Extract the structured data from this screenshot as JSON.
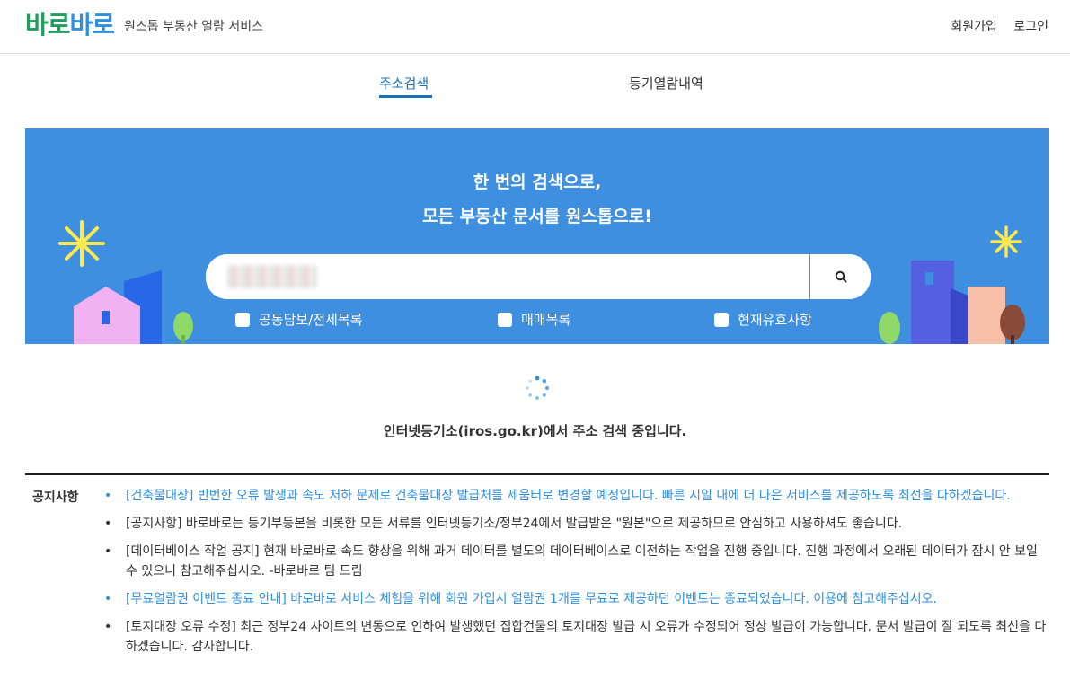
{
  "header": {
    "logo_part1": "바로",
    "logo_part2": "바로",
    "subtitle": "원스톱 부동산 열람 서비스",
    "signup": "회원가입",
    "login": "로그인"
  },
  "tabs": [
    {
      "label": "주소검색",
      "active": true
    },
    {
      "label": "등기열람내역",
      "active": false
    }
  ],
  "hero": {
    "line1": "한 번의 검색으로,",
    "line2": "모든 부동산 문서를 원스톱으로!",
    "search_icon": "search-icon",
    "checkboxes": [
      {
        "label": "공동담보/전세목록",
        "checked": false
      },
      {
        "label": "매매목록",
        "checked": false
      },
      {
        "label": "현재유효사항",
        "checked": false
      }
    ],
    "bg_color": "#3e8fe0"
  },
  "loading": {
    "message": "인터넷등기소(iros.go.kr)에서 주소 검색 중입니다."
  },
  "notices": {
    "label": "공지사항",
    "items": [
      {
        "text": "[건축물대장] 빈번한 오류 발생과 속도 저하 문제로 건축물대장 발급처를 세움터로 변경할 예정입니다. 빠른 시일 내에 더 나은 서비스를 제공하도록 최선을 다하겠습니다.",
        "highlight": true
      },
      {
        "text": "[공지사항] 바로바로는 등기부등본을 비롯한 모든 서류를 인터넷등기소/정부24에서 발급받은 \"원본\"으로 제공하므로 안심하고 사용하셔도 좋습니다.",
        "highlight": false
      },
      {
        "text": "[데이터베이스 작업 공지] 현재 바로바로 속도 향상을 위해 과거 데이터를 별도의 데이터베이스로 이전하는 작업을 진행 중입니다. 진행 과정에서 오래된 데이터가 잠시 안 보일 수 있으니 참고해주십시오. -바로바로 팀 드림",
        "highlight": false
      },
      {
        "text": "[무료열람권 이벤트 종료 안내] 바로바로 서비스 체험을 위해 회원 가입시 열람권 1개를 무료로 제공하던 이벤트는 종료되었습니다. 이용에 참고해주십시오.",
        "highlight": true
      },
      {
        "text": "[토지대장 오류 수정] 최근 정부24 사이트의 변동으로 인하여 발생했던 집합건물의 토지대장 발급 시 오류가 수정되어 정상 발급이 가능합니다. 문서 발급이 잘 되도록 최선을 다하겠습니다. 감사합니다.",
        "highlight": false
      }
    ]
  }
}
